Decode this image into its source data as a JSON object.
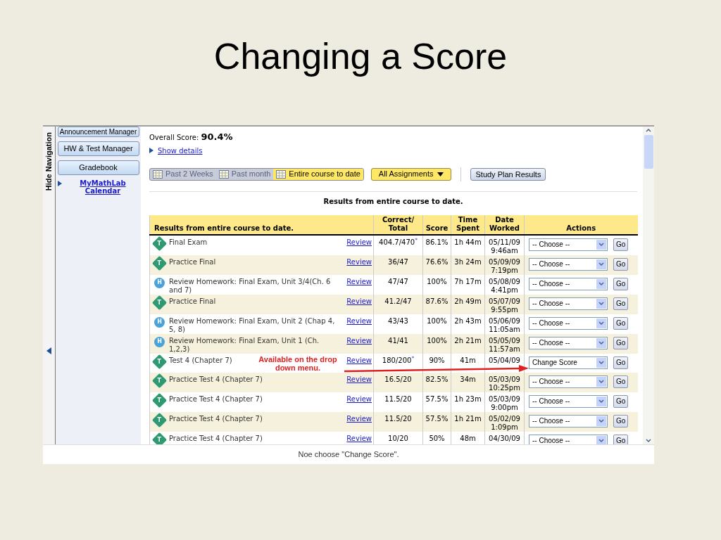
{
  "slide_title": "Changing a Score",
  "nav": {
    "toggle_label": "Hide Navigation",
    "buttons": [
      "Announcement Manager",
      "HW & Test Manager",
      "Gradebook"
    ],
    "link": "MyMathLab Calendar"
  },
  "overall": {
    "label": "Overall Score:",
    "value": "90.4%"
  },
  "show_details": "Show details",
  "range_tabs": [
    {
      "label": "Past 2 Weeks",
      "selected": false
    },
    {
      "label": "Past month",
      "selected": false
    },
    {
      "label": "Entire course to date",
      "selected": true
    }
  ],
  "filter": "All Assignments",
  "study_plan": "Study Plan Results",
  "results_caption": "Results from entire course to date.",
  "table": {
    "columns": [
      "Results from entire course to date.",
      "Correct/ Total",
      "Score",
      "Time Spent",
      "Date Worked",
      "Actions"
    ],
    "rows": [
      {
        "kind": "test",
        "badge": "T",
        "name": "Final Exam",
        "review": "Review",
        "correct": "404.7/470",
        "mark": "*",
        "score": "86.1%",
        "time": "1h 44m",
        "date": "05/11/09",
        "clock": "9:46am",
        "action": "-- Choose --",
        "go": "Go"
      },
      {
        "kind": "test",
        "badge": "T",
        "name": "Practice Final",
        "review": "Review",
        "correct": "36/47",
        "score": "76.6%",
        "time": "3h 24m",
        "date": "05/09/09",
        "clock": "7:19pm",
        "action": "-- Choose --",
        "go": "Go"
      },
      {
        "kind": "homework",
        "badge": "H",
        "name": "Review Homework: Final Exam, Unit 3/4(Ch. 6 and 7)",
        "review": "Review",
        "correct": "47/47",
        "score": "100%",
        "time": "7h 17m",
        "date": "05/08/09",
        "clock": "4:41pm",
        "action": "-- Choose --",
        "go": "Go"
      },
      {
        "kind": "test",
        "badge": "T",
        "name": "Practice Final",
        "review": "Review",
        "correct": "41.2/47",
        "score": "87.6%",
        "time": "2h 49m",
        "date": "05/07/09",
        "clock": "9:55pm",
        "action": "-- Choose --",
        "go": "Go"
      },
      {
        "kind": "homework",
        "badge": "H",
        "name": "Review Homework: Final Exam, Unit 2 (Chap 4, 5, 8)",
        "review": "Review",
        "correct": "43/43",
        "score": "100%",
        "time": "2h 43m",
        "date": "05/06/09",
        "clock": "11:05am",
        "action": "-- Choose --",
        "go": "Go"
      },
      {
        "kind": "homework",
        "badge": "H",
        "name": "Review Homework: Final Exam, Unit 1 (Ch. 1,2,3)",
        "review": "Review",
        "correct": "41/41",
        "score": "100%",
        "time": "2h 21m",
        "date": "05/05/09",
        "clock": "11:57am",
        "action": "-- Choose --",
        "go": "Go"
      },
      {
        "kind": "test",
        "badge": "T",
        "name": "Test 4 (Chapter 7)",
        "review": "Review",
        "correct": "180/200",
        "mark": "*",
        "score": "90%",
        "time": "41m",
        "date": "05/04/09",
        "action": "Change Score",
        "go": "Go",
        "callout": "Available on the drop down menu."
      },
      {
        "kind": "test",
        "badge": "T",
        "name": "Practice Test 4 (Chapter 7)",
        "review": "Review",
        "correct": "16.5/20",
        "score": "82.5%",
        "time": "34m",
        "date": "05/03/09",
        "clock": "10:25pm",
        "action": "-- Choose --",
        "go": "Go"
      },
      {
        "kind": "test",
        "badge": "T",
        "name": "Practice Test 4 (Chapter 7)",
        "review": "Review",
        "correct": "11.5/20",
        "score": "57.5%",
        "time": "1h 23m",
        "date": "05/03/09",
        "clock": "9:00pm",
        "action": "-- Choose --",
        "go": "Go"
      },
      {
        "kind": "test",
        "badge": "T",
        "name": "Practice Test 4 (Chapter 7)",
        "review": "Review",
        "correct": "11.5/20",
        "score": "57.5%",
        "time": "1h 21m",
        "date": "05/02/09",
        "clock": "1:09pm",
        "action": "-- Choose --",
        "go": "Go"
      },
      {
        "kind": "test",
        "badge": "T",
        "name": "Practice Test 4 (Chapter 7)",
        "review": "Review",
        "correct": "10/20",
        "score": "50%",
        "time": "48m",
        "date": "04/30/09",
        "action": "-- Choose --",
        "go": "Go"
      }
    ]
  },
  "footer": "Noe choose \"Change Score\"."
}
